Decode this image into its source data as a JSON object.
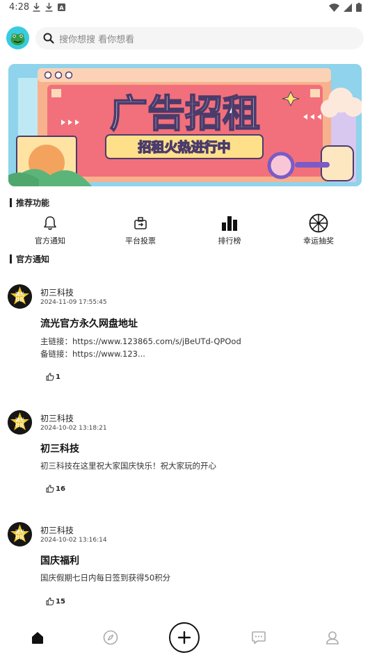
{
  "status_bar": {
    "time": "4:28"
  },
  "search": {
    "placeholder": "搜你想搜 看你想看"
  },
  "banner": {
    "headline": "广告招租",
    "subline": "招租火热进行中"
  },
  "recommended": {
    "title": "推荐功能",
    "items": [
      {
        "label": "官方通知",
        "icon": "bell-icon"
      },
      {
        "label": "平台投票",
        "icon": "vote-icon"
      },
      {
        "label": "排行榜",
        "icon": "bar-chart-icon"
      },
      {
        "label": "幸运抽奖",
        "icon": "lucky-wheel-icon"
      }
    ]
  },
  "notices": {
    "title": "官方通知",
    "avatar_text": "流光社区",
    "posts": [
      {
        "author": "初三科技",
        "date": "2024-11-09 17:55:45",
        "title": "流光官方永久网盘地址",
        "body_line1": "主链接：https://www.123865.com/s/jBeUTd-QPOod",
        "body_line2": "备链接：https://www.123...",
        "likes": "1"
      },
      {
        "author": "初三科技",
        "date": "2024-10-02 13:18:21",
        "title": "初三科技",
        "body_line1": "初三科技在这里祝大家国庆快乐！祝大家玩的开心",
        "likes": "16"
      },
      {
        "author": "初三科技",
        "date": "2024-10-02 13:16:14",
        "title": "国庆福利",
        "body_line1": "国庆假期七日内每日签到获得50积分",
        "likes": "15"
      }
    ]
  },
  "bottom_nav": [
    {
      "name": "home",
      "icon": "home-icon"
    },
    {
      "name": "discover",
      "icon": "compass-icon"
    },
    {
      "name": "publish",
      "icon": "plus-icon"
    },
    {
      "name": "messages",
      "icon": "chat-icon"
    },
    {
      "name": "profile",
      "icon": "user-icon"
    }
  ]
}
